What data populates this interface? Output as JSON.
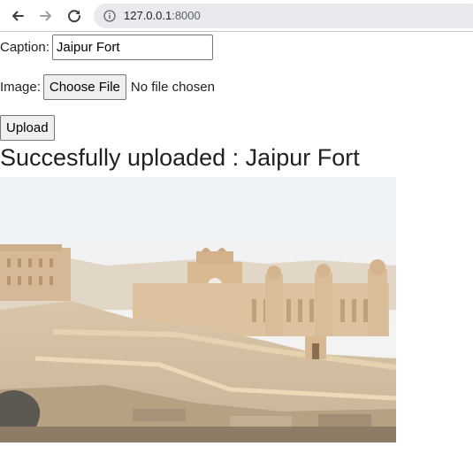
{
  "browser": {
    "url_host": "127.0.0.1",
    "url_port": ":8000",
    "icons": {
      "back": "arrow-left-icon",
      "forward": "arrow-right-icon",
      "reload": "reload-icon",
      "info": "info-icon"
    }
  },
  "form": {
    "caption_label": "Caption:",
    "caption_value": "Jaipur Fort",
    "image_label": "Image:",
    "choose_file_label": "Choose File",
    "no_file_text": "No file chosen",
    "upload_label": "Upload"
  },
  "result": {
    "headline": "Succesfully uploaded : Jaipur Fort"
  }
}
